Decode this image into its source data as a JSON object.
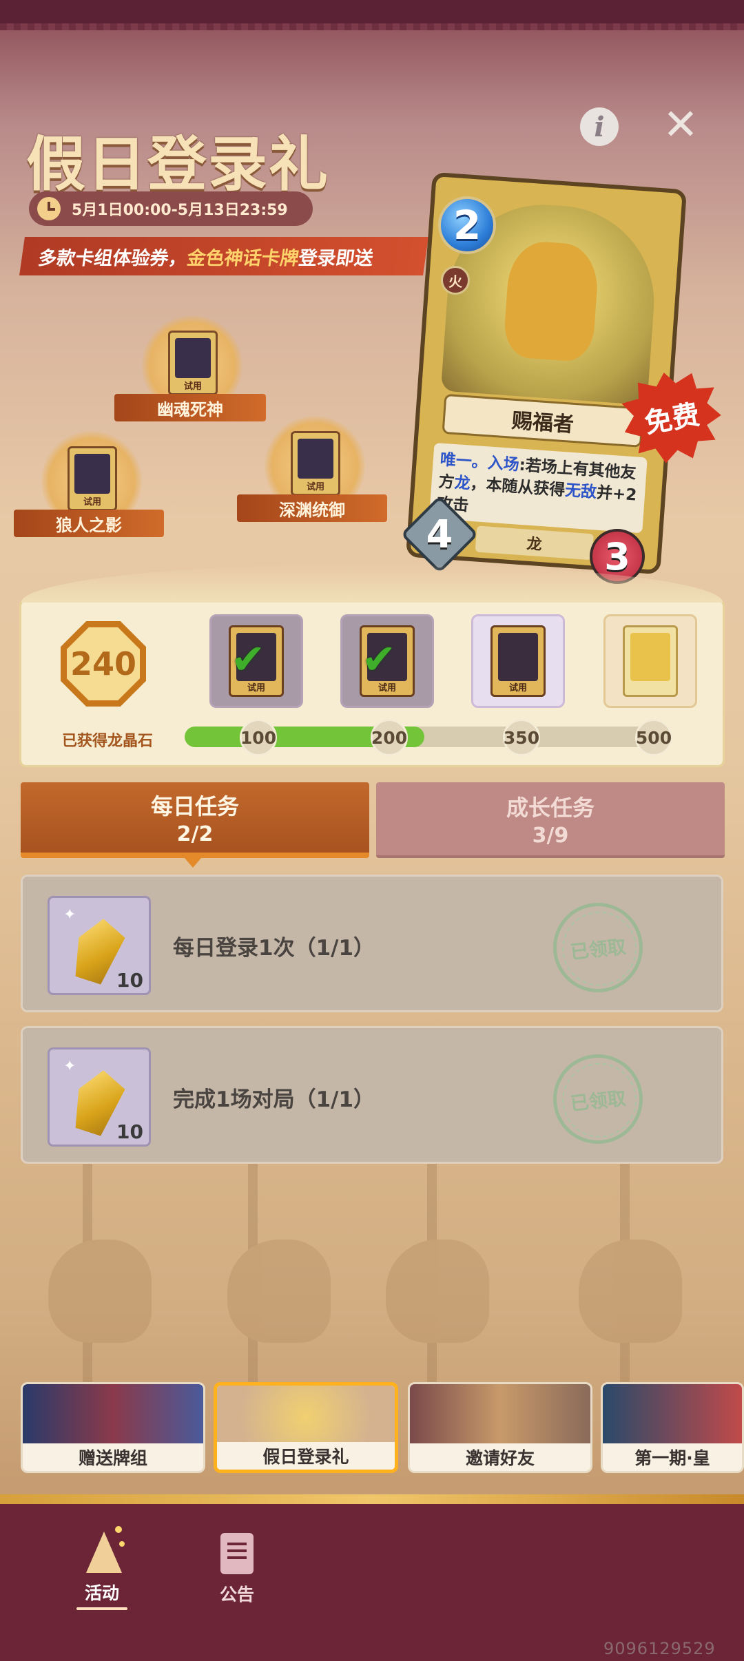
{
  "header": {
    "title": "假日登录礼",
    "date_range": "5月1日00:00-5月13日23:59",
    "promo_prefix": "多款卡组体验券，",
    "promo_highlight": "金色神话卡牌",
    "promo_suffix": "登录即送"
  },
  "decks": [
    {
      "label": "幽魂死神",
      "tag": "试用"
    },
    {
      "label": "狼人之影",
      "tag": "试用"
    },
    {
      "label": "深渊统御",
      "tag": "试用"
    }
  ],
  "featured_card": {
    "mana": "2",
    "element": "火",
    "name": "赐福者",
    "desc_kw1": "唯一。入场",
    "desc_p1": ":若场上有其他友方",
    "desc_kw2": "龙",
    "desc_p2": "，本随从获得",
    "desc_kw3": "无敌",
    "desc_p3": "并+2攻击",
    "tribe": "龙",
    "attack": "4",
    "health": "3",
    "badge": "免费"
  },
  "progress": {
    "score": "240",
    "score_label": "已获得龙晶石",
    "current": 240,
    "max": 500,
    "milestones": [
      {
        "value": "100",
        "status": "claimed",
        "tag": "试用"
      },
      {
        "value": "200",
        "status": "claimed",
        "tag": "试用"
      },
      {
        "value": "350",
        "status": "locked",
        "tag": "试用"
      },
      {
        "value": "500",
        "status": "locked",
        "tag": ""
      }
    ]
  },
  "tabs": [
    {
      "label": "每日任务",
      "count": "2/2",
      "active": true
    },
    {
      "label": "成长任务",
      "count": "3/9",
      "active": false
    }
  ],
  "tasks": [
    {
      "name": "每日登录1次（1/1）",
      "qty": "10",
      "status": "已领取"
    },
    {
      "name": "完成1场对局（1/1）",
      "qty": "10",
      "status": "已领取"
    }
  ],
  "events": [
    {
      "caption": "赠送牌组",
      "selected": false
    },
    {
      "caption": "假日登录礼",
      "selected": true
    },
    {
      "caption": "邀请好友",
      "selected": false
    },
    {
      "caption": "第一期·皇",
      "selected": false
    }
  ],
  "nav": [
    {
      "label": "活动",
      "icon": "party-popper-icon",
      "active": true
    },
    {
      "label": "公告",
      "icon": "document-icon",
      "active": false
    }
  ],
  "watermark": "9096129529",
  "colors": {
    "accent_orange": "#c2692c",
    "progress_green": "#74c43a",
    "nav_bg": "#6b2537",
    "free_badge": "#d6331f"
  }
}
